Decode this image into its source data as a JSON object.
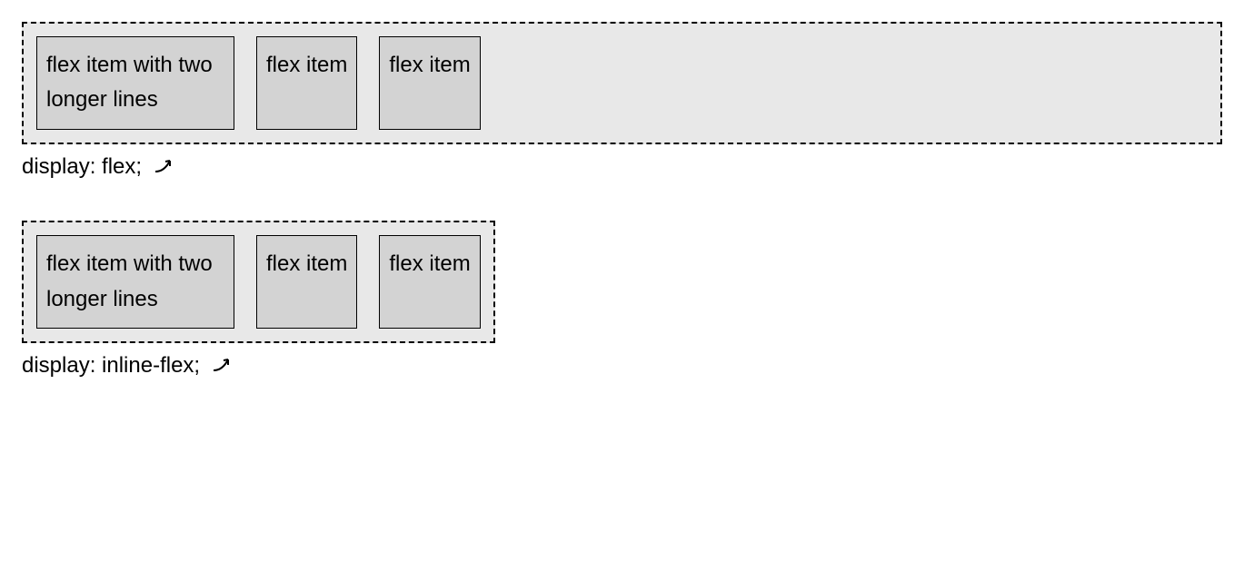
{
  "flex_demo": {
    "items": [
      "flex item with two longer lines",
      "flex item",
      "flex item"
    ],
    "caption": "display: flex;"
  },
  "inline_flex_demo": {
    "items": [
      "flex item with two longer lines",
      "flex item",
      "flex item"
    ],
    "caption": "display: inline-flex;"
  }
}
